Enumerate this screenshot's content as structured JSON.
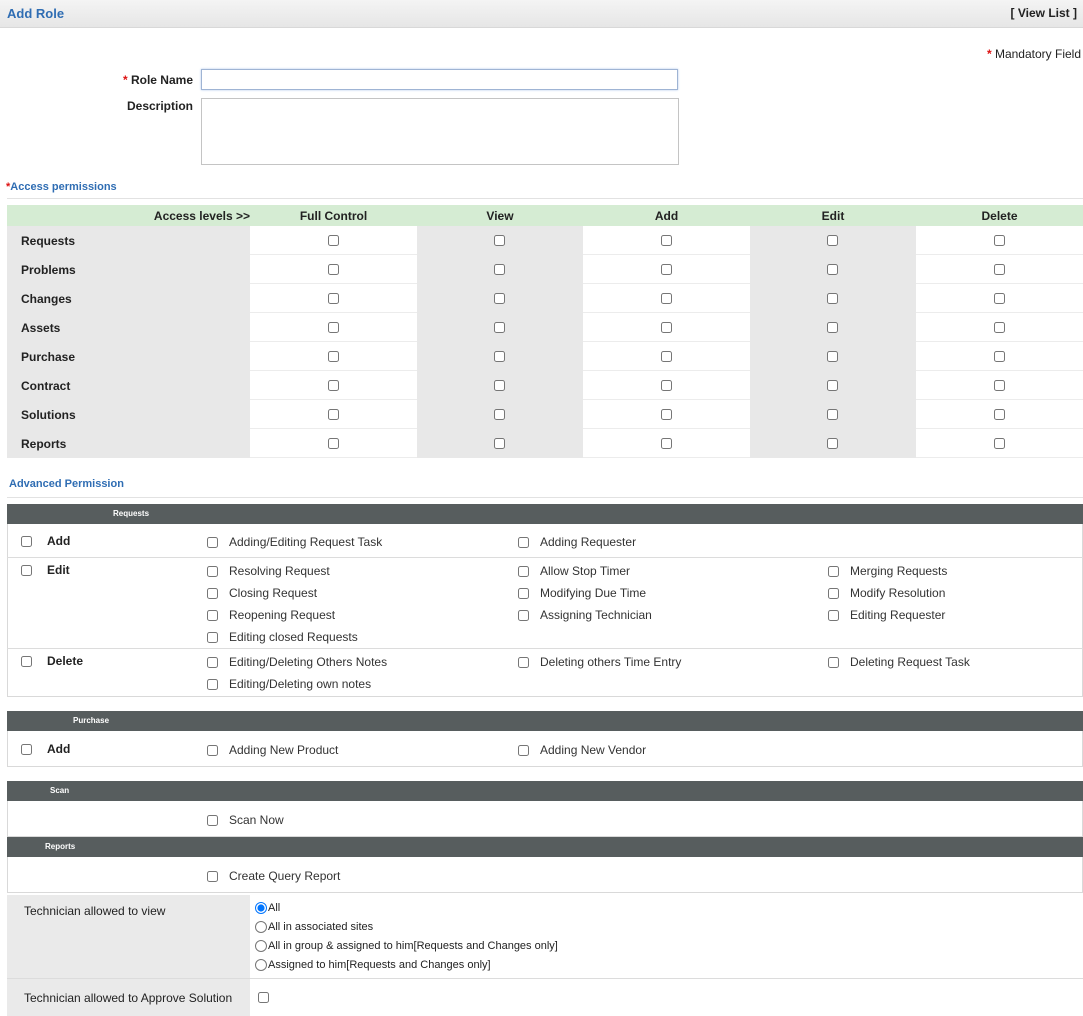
{
  "header": {
    "title": "Add Role",
    "view_list": "View List",
    "bracket_open": "[ ",
    "bracket_close": " ]"
  },
  "mandatory_note": "Mandatory Field",
  "form": {
    "role_name_label": "Role Name",
    "role_name_value": "",
    "description_label": "Description",
    "description_value": ""
  },
  "access": {
    "title": "Access permissions",
    "levels_label": "Access levels >>",
    "columns": [
      "Full Control",
      "View",
      "Add",
      "Edit",
      "Delete"
    ],
    "modules": [
      "Requests",
      "Problems",
      "Changes",
      "Assets",
      "Purchase",
      "Contract",
      "Solutions",
      "Reports"
    ]
  },
  "advanced": {
    "title": "Advanced Permission",
    "requests": {
      "header": "Requests",
      "add_label": "Add",
      "add_options": [
        "Adding/Editing Request Task",
        "Adding Requester"
      ],
      "edit_label": "Edit",
      "edit_options": [
        "Resolving Request",
        "Allow Stop Timer",
        "Merging Requests",
        "Closing Request",
        "Modifying Due Time",
        "Modify Resolution",
        "Reopening Request",
        "Assigning Technician",
        "Editing Requester",
        "Editing closed Requests"
      ],
      "delete_label": "Delete",
      "delete_options": [
        "Editing/Deleting Others Notes",
        "Deleting others Time Entry",
        "Deleting Request Task",
        "Editing/Deleting own notes"
      ]
    },
    "purchase": {
      "header": "Purchase",
      "add_label": "Add",
      "add_options": [
        "Adding New Product",
        "Adding New Vendor"
      ]
    },
    "scan": {
      "header": "Scan",
      "options": [
        "Scan Now"
      ]
    },
    "reports": {
      "header": "Reports",
      "options": [
        "Create Query Report"
      ]
    }
  },
  "technician_view": {
    "label": "Technician allowed to view",
    "options": [
      "All",
      "All in associated sites",
      "All in group & assigned to him[Requests and Changes only]",
      "Assigned to him[Requests and Changes only]"
    ],
    "selected": "All"
  },
  "technician_approve": {
    "label": "Technician allowed to Approve Solution"
  }
}
